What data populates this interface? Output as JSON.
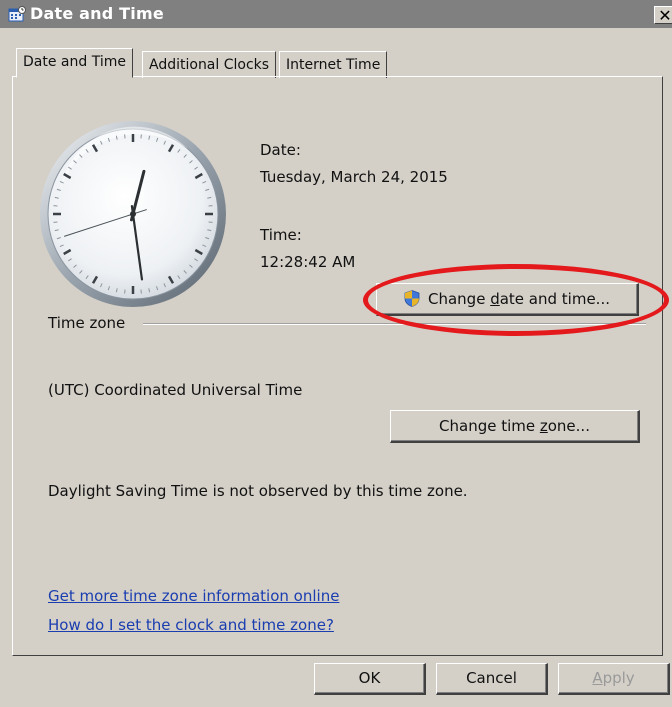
{
  "window": {
    "title": "Date and Time",
    "close_glyph": "✕",
    "icon": "calendar-clock-icon"
  },
  "tabs": [
    {
      "label": "Date and Time",
      "active": true
    },
    {
      "label": "Additional Clocks",
      "active": false
    },
    {
      "label": "Internet Time",
      "active": false
    }
  ],
  "clock": {
    "hour": 12,
    "minute": 28,
    "second": 42
  },
  "date": {
    "label": "Date:",
    "value": "Tuesday, March 24, 2015"
  },
  "time": {
    "label": "Time:",
    "value": "12:28:42 AM"
  },
  "change_datetime_button": {
    "label_pre": "Change ",
    "label_key": "d",
    "label_post": "ate and time...",
    "icon": "uac-shield-icon"
  },
  "timezone": {
    "group_label": "Time zone",
    "value": "(UTC) Coordinated Universal Time",
    "button_pre": "Change time ",
    "button_key": "z",
    "button_post": "one...",
    "dst_note": "Daylight Saving Time is not observed by this time zone."
  },
  "links": {
    "more_info": "Get more time zone information online",
    "how_to": "How do I set the clock and time zone?"
  },
  "footer": {
    "ok": "OK",
    "cancel": "Cancel",
    "apply_key": "A",
    "apply_rest": "pply"
  },
  "colors": {
    "dialog_bg": "#d4d0c8",
    "titlebar_bg": "#808080",
    "link": "#1a3db0",
    "highlight": "#e4191c"
  }
}
